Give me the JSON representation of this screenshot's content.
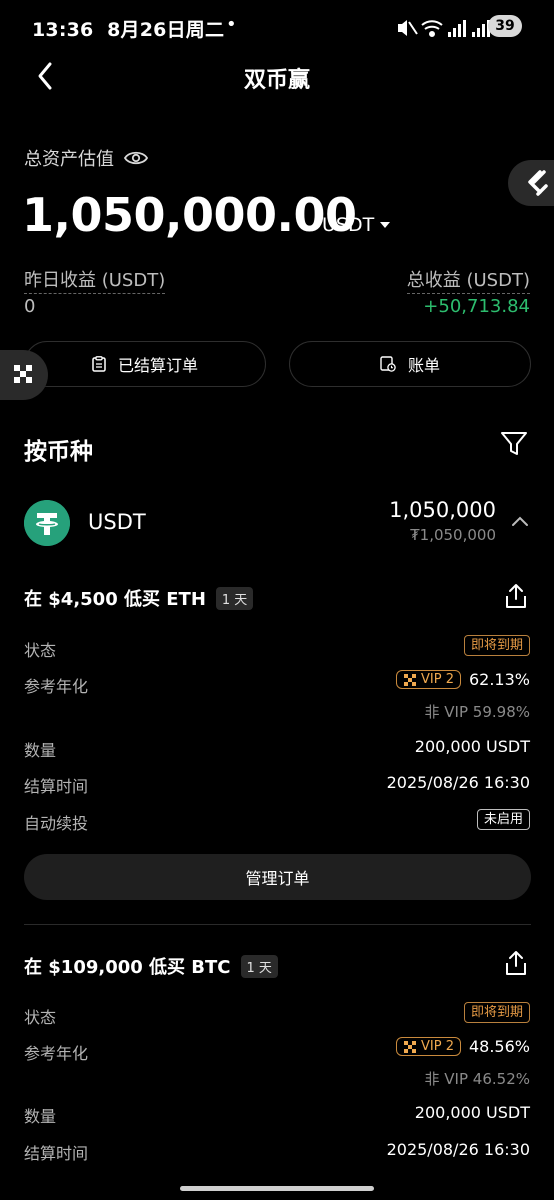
{
  "status_bar": {
    "time": "13:36",
    "date": "8月26日周二",
    "dot": "•",
    "battery": "39"
  },
  "header": {
    "title": "双币赢",
    "back_icon": "chevron-left-icon"
  },
  "summary": {
    "asset_label": "总资产估值",
    "total_amount": "1,050,000.00",
    "unit": "USDT",
    "yesterday_label": "昨日收益 (USDT)",
    "yesterday_value": "0",
    "total_label": "总收益 (USDT)",
    "total_value": "+50,713.84",
    "settled_orders_label": "已结算订单",
    "bill_label": "账单"
  },
  "section": {
    "title": "按币种"
  },
  "coin": {
    "name": "USDT",
    "amount": "1,050,000",
    "fiat": "₮1,050,000"
  },
  "orders": [
    {
      "title": "在 $4,500 低买 ETH",
      "tag": "1 天",
      "status_label": "状态",
      "status_value": "即将到期",
      "apr_label": "参考年化",
      "vip_label": "VIP 2",
      "apr_value": "62.13%",
      "nonvip": "非 VIP 59.98%",
      "qty_label": "数量",
      "qty_value": "200,000 USDT",
      "settle_label": "结算时间",
      "settle_value": "2025/08/26 16:30",
      "auto_label": "自动续投",
      "auto_value": "未启用",
      "manage_label": "管理订单"
    },
    {
      "title": "在 $109,000 低买 BTC",
      "tag": "1 天",
      "status_label": "状态",
      "status_value": "即将到期",
      "apr_label": "参考年化",
      "vip_label": "VIP 2",
      "apr_value": "48.56%",
      "nonvip": "非 VIP 46.52%",
      "qty_label": "数量",
      "qty_value": "200,000 USDT",
      "settle_label": "结算时间",
      "settle_value": "2025/08/26 16:30"
    }
  ],
  "colors": {
    "positive": "#2dbd6e",
    "warning": "#e59a45",
    "usdt": "#26a17b",
    "background": "#000000"
  }
}
